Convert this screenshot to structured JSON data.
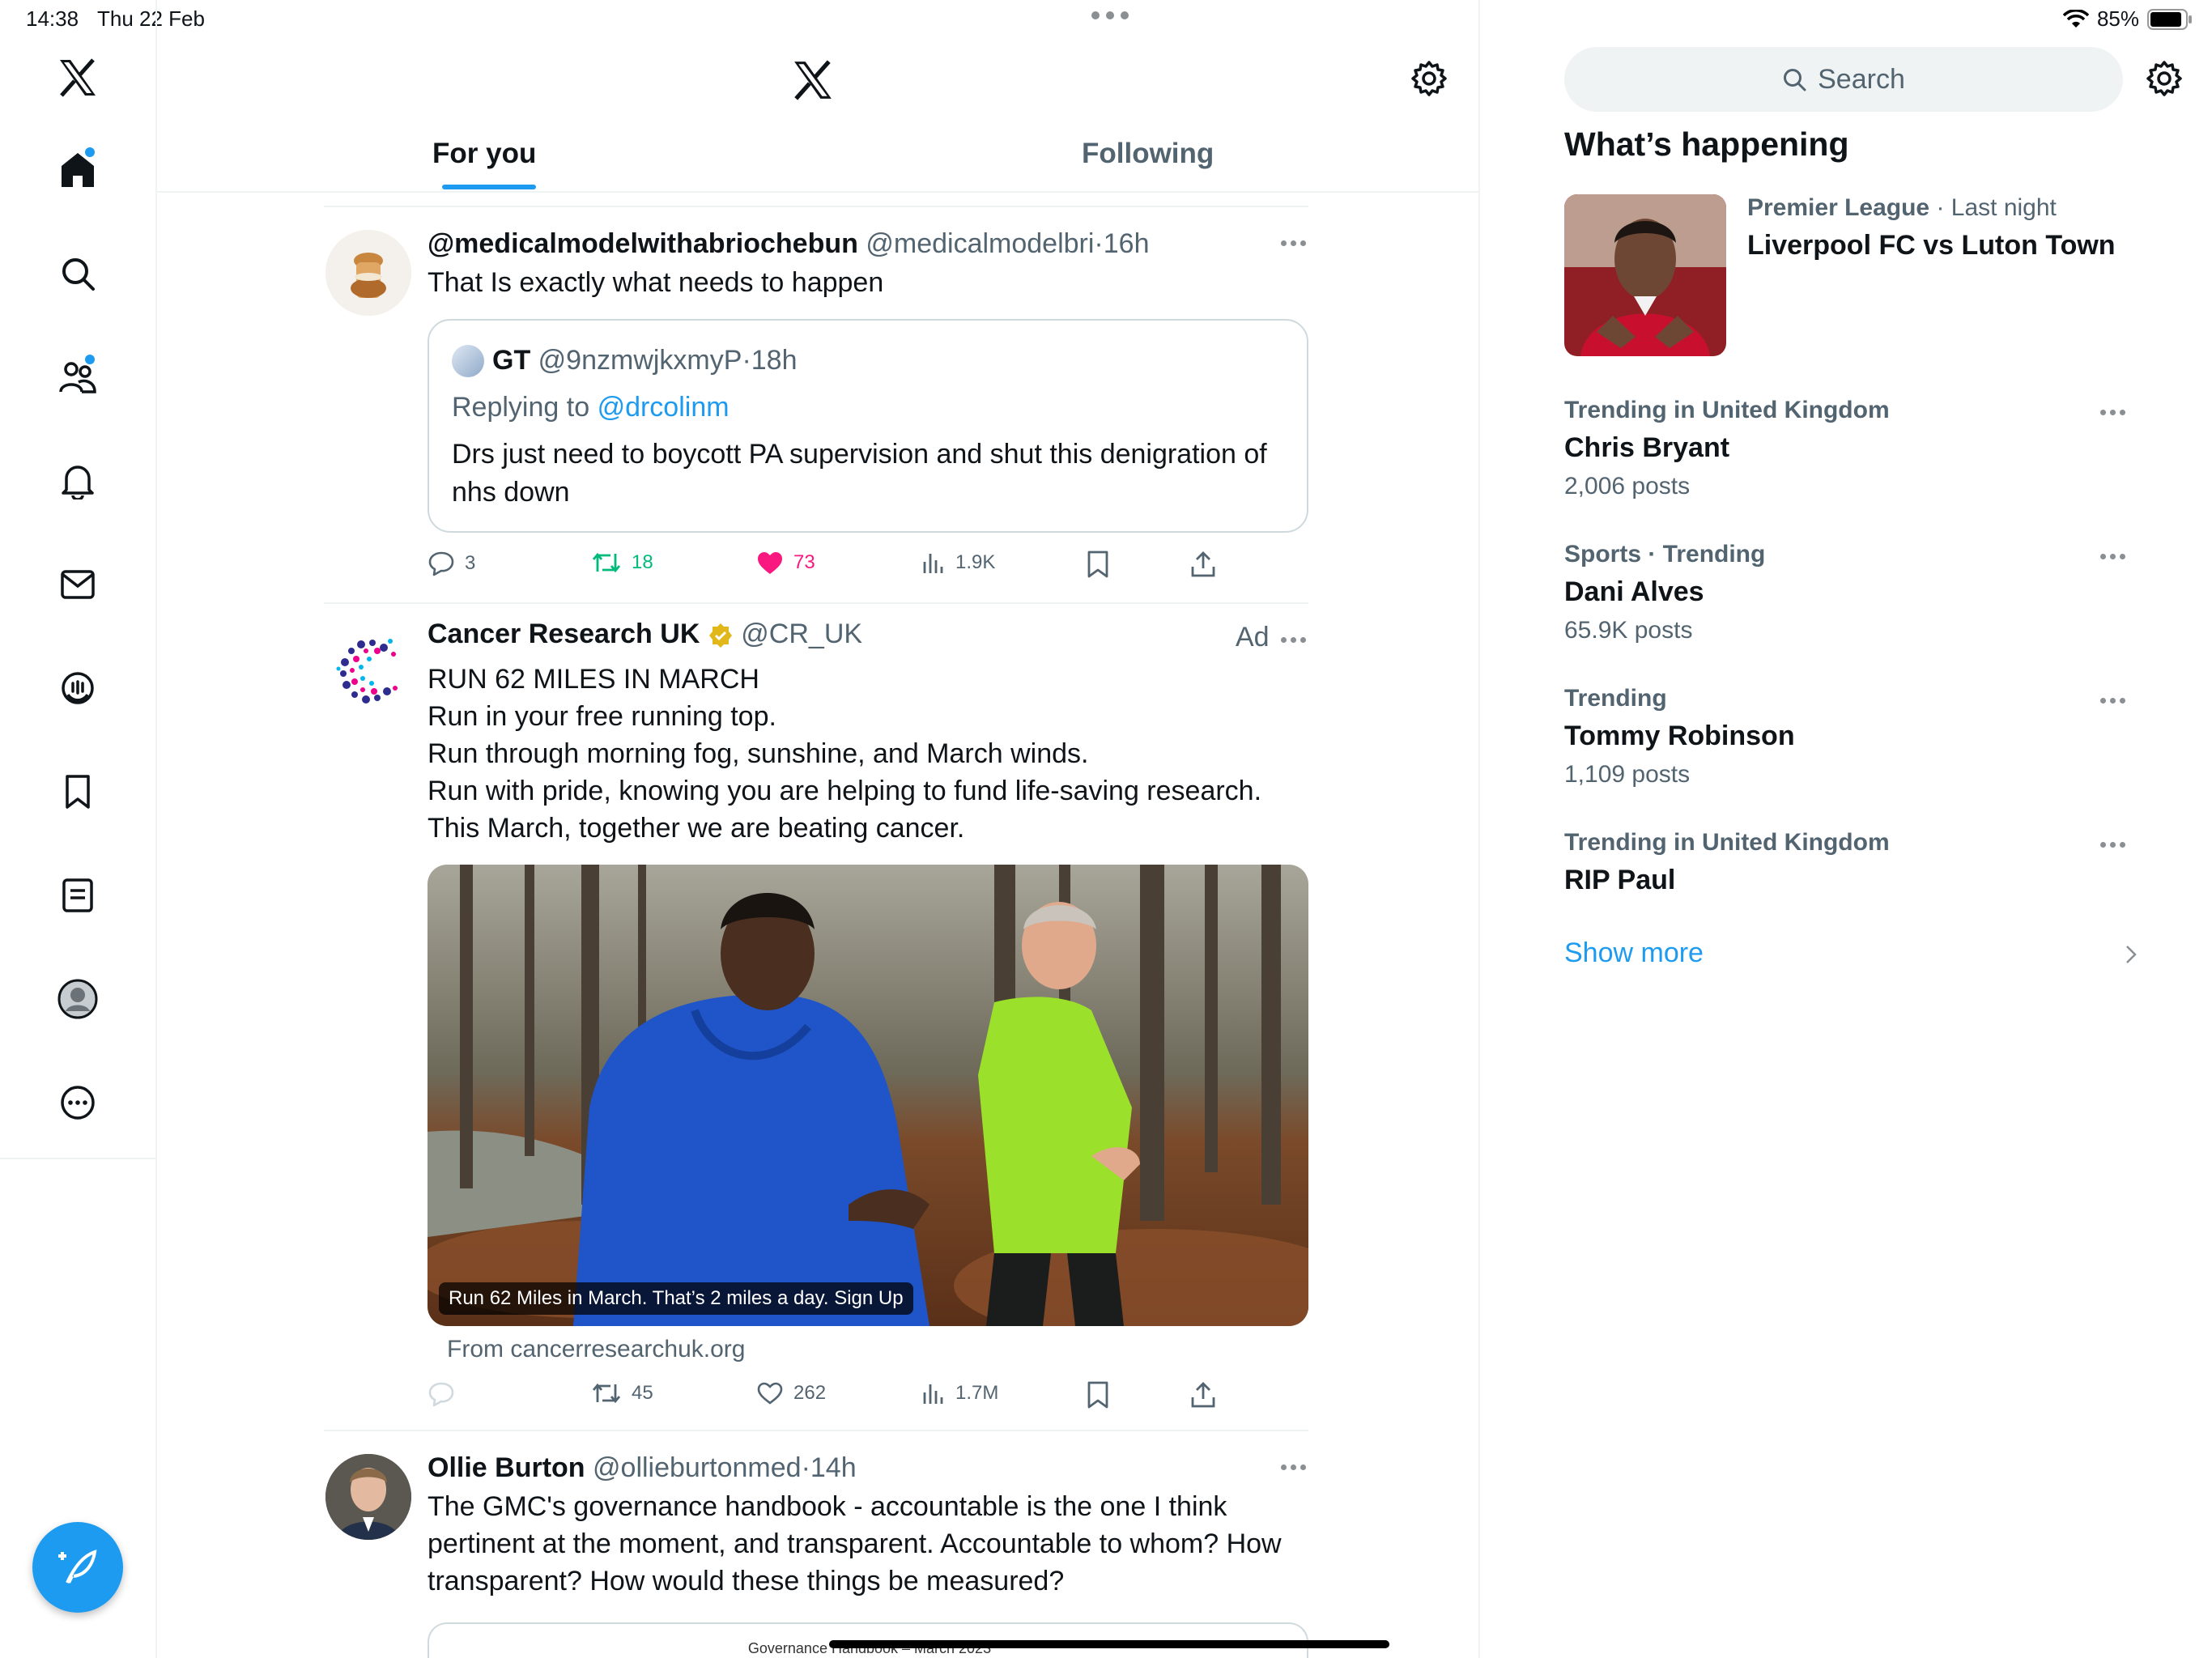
{
  "status_bar": {
    "time": "14:38",
    "date": "Thu 22 Feb",
    "battery": "85%"
  },
  "colors": {
    "accent": "#1d9bf0",
    "like": "#f91880",
    "repost": "#00ba7c",
    "verified": "#e2b719"
  },
  "nav": {
    "items": [
      "home-icon",
      "search-icon",
      "communities-icon",
      "notifications-icon",
      "messages-icon",
      "grok-icon",
      "bookmarks-icon",
      "lists-icon",
      "profile-icon",
      "more-icon"
    ]
  },
  "header": {
    "tabs": [
      {
        "label": "For you",
        "active": true
      },
      {
        "label": "Following",
        "active": false
      }
    ]
  },
  "posts": [
    {
      "name": "@medicalmodelwithabriochebun",
      "handle": "@medicalmodelbri",
      "time": "16h",
      "text": "That Is exactly what needs to happen",
      "quote": {
        "name": "GT",
        "handle": "@9nzmwjkxmyP",
        "time": "18h",
        "replying_prefix": "Replying to",
        "replying_to": "@drcolinm",
        "text": "Drs just need to boycott PA supervision and shut this denigration of nhs down"
      },
      "stats": {
        "replies": "3",
        "reposts": "18",
        "likes": "73",
        "views": "1.9K"
      }
    },
    {
      "name": "Cancer Research UK",
      "handle": "@CR_UK",
      "ad_label": "Ad",
      "lines": [
        "RUN 62 MILES IN MARCH",
        "Run in your free running top.",
        "Run through morning fog, sunshine, and March winds.",
        "Run with pride, knowing you are helping to fund life-saving research.",
        "This March, together we are beating cancer."
      ],
      "media_caption": "Run 62 Miles in March. That’s 2 miles a day.  Sign Up",
      "source": "From cancerresearchuk.org",
      "stats": {
        "replies": "",
        "reposts": "45",
        "likes": "262",
        "views": "1.7M"
      }
    },
    {
      "name": "Ollie Burton",
      "handle": "@ollieburtonmed",
      "time": "14h",
      "lines": [
        "The GMC's governance handbook - accountable is the one I think",
        "pertinent at the moment, and transparent. Accountable to whom? How",
        "transparent? How would these things be measured?"
      ],
      "card_text": "Governance Handbook – March 2023"
    }
  ],
  "sidebar": {
    "search_placeholder": "Search",
    "heading": "What’s happening",
    "featured": {
      "category": "Premier League",
      "time": "Last night",
      "title": "Liverpool FC vs Luton Town"
    },
    "trends": [
      {
        "meta": "Trending in United Kingdom",
        "title": "Chris Bryant",
        "count": "2,006 posts"
      },
      {
        "meta": "Sports · Trending",
        "title": "Dani Alves",
        "count": "65.9K posts"
      },
      {
        "meta": "Trending",
        "title": "Tommy Robinson",
        "count": "1,109 posts"
      },
      {
        "meta": "Trending in United Kingdom",
        "title": "RIP Paul",
        "count": ""
      }
    ],
    "show_more": "Show more"
  }
}
